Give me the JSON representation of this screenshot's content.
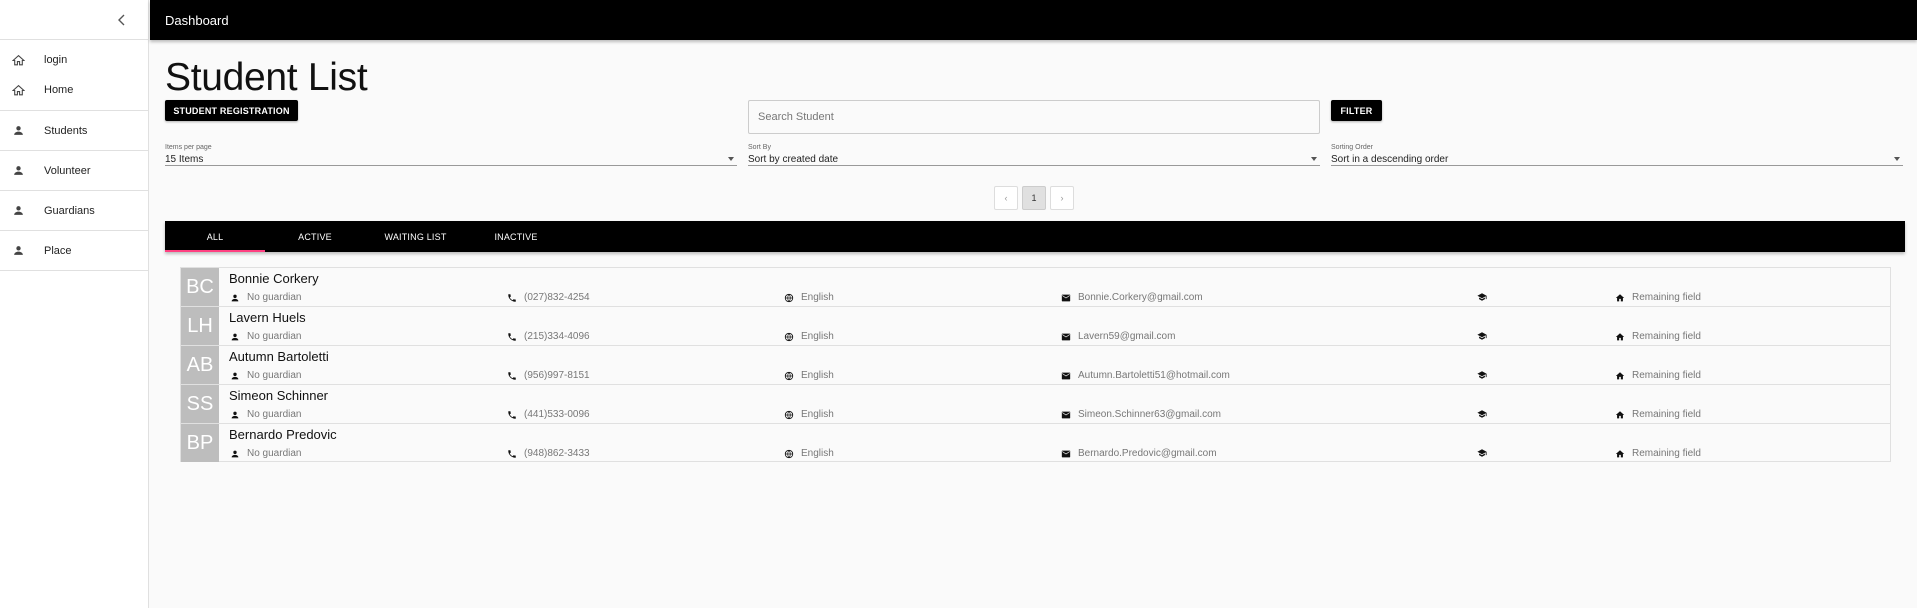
{
  "topbar": {
    "title": "Dashboard"
  },
  "sidebar": {
    "items": [
      {
        "label": "login",
        "icon": "home-icon"
      },
      {
        "label": "Home",
        "icon": "home-icon"
      },
      {
        "label": "Students",
        "icon": "person-icon"
      },
      {
        "label": "Volunteer",
        "icon": "person-icon"
      },
      {
        "label": "Guardians",
        "icon": "person-icon"
      },
      {
        "label": "Place",
        "icon": "person-icon"
      }
    ]
  },
  "page": {
    "title": "Student List",
    "registration_button": "STUDENT REGISTRATION",
    "search_placeholder": "Search Student",
    "filter_button": "FILTER"
  },
  "selects": {
    "items_per_page": {
      "caption": "Items per page",
      "value": "15 Items"
    },
    "sort_by": {
      "caption": "Sort By",
      "value": "Sort by created date"
    },
    "sorting_order": {
      "caption": "Sorting Order",
      "value": "Sort in a descending order"
    }
  },
  "pagination": {
    "prev": "‹",
    "current": "1",
    "next": "›"
  },
  "tabs": [
    {
      "label": "ALL",
      "active": true
    },
    {
      "label": "ACTIVE",
      "active": false
    },
    {
      "label": "WAITING LIST",
      "active": false
    },
    {
      "label": "INACTIVE",
      "active": false
    }
  ],
  "students": [
    {
      "initials": "BC",
      "name": "Bonnie Corkery",
      "guardian": "No guardian",
      "phone": "(027)832-4254",
      "language": "English",
      "email": "Bonnie.Corkery@gmail.com",
      "location": "Remaining field"
    },
    {
      "initials": "LH",
      "name": "Lavern Huels",
      "guardian": "No guardian",
      "phone": "(215)334-4096",
      "language": "English",
      "email": "Lavern59@gmail.com",
      "location": "Remaining field"
    },
    {
      "initials": "AB",
      "name": "Autumn Bartoletti",
      "guardian": "No guardian",
      "phone": "(956)997-8151",
      "language": "English",
      "email": "Autumn.Bartoletti51@hotmail.com",
      "location": "Remaining field"
    },
    {
      "initials": "SS",
      "name": "Simeon Schinner",
      "guardian": "No guardian",
      "phone": "(441)533-0096",
      "language": "English",
      "email": "Simeon.Schinner63@gmail.com",
      "location": "Remaining field"
    },
    {
      "initials": "BP",
      "name": "Bernardo Predovic",
      "guardian": "No guardian",
      "phone": "(948)862-3433",
      "language": "English",
      "email": "Bernardo.Predovic@gmail.com",
      "location": "Remaining field"
    }
  ],
  "colors": {
    "accent": "#ff4081",
    "bar": "#000000",
    "avatar": "#bdbdbd"
  }
}
